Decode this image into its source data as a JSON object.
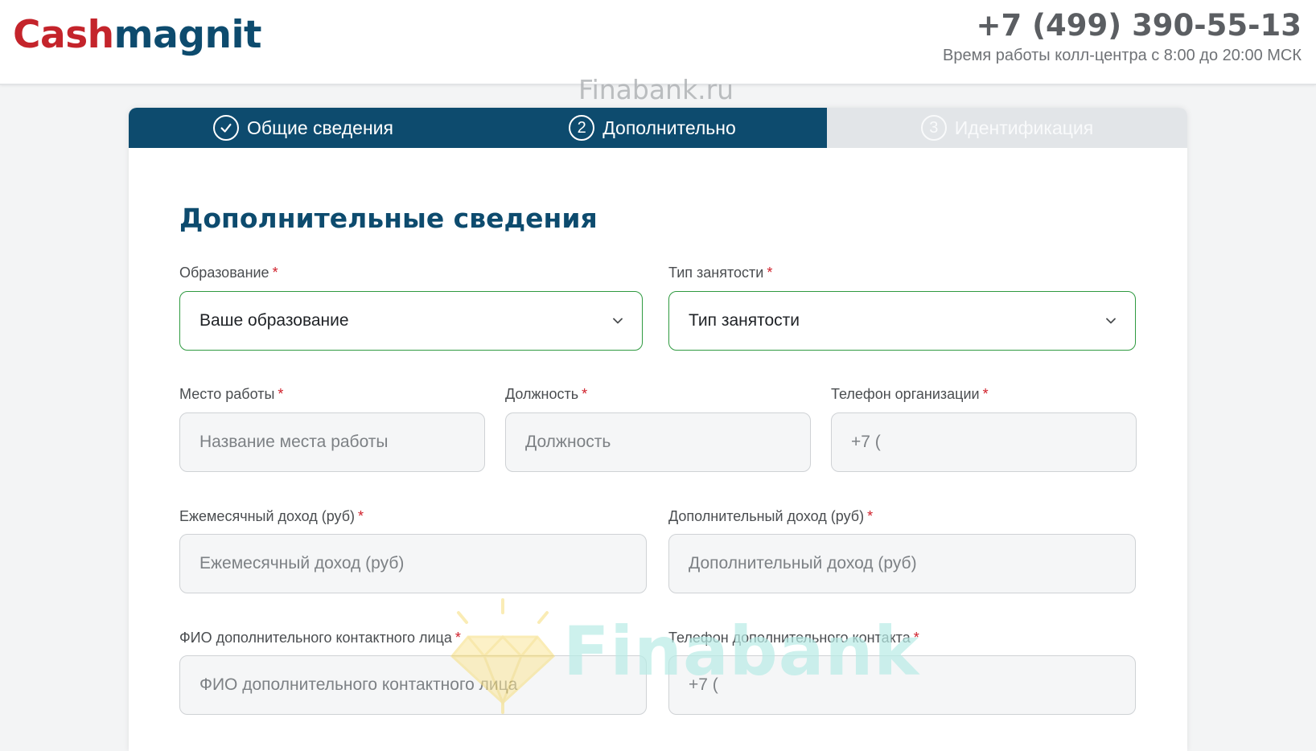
{
  "header": {
    "logo_part1": "Cash",
    "logo_part2": "magnit",
    "phone": "+7 (499) 390-55-13",
    "hours": "Время работы колл-центра с 8:00 до 20:00 МСК"
  },
  "watermark": {
    "top": "Finabank.ru",
    "bottom": "Finabank"
  },
  "stepper": {
    "steps": [
      {
        "num": "✓",
        "label": "Общие сведения",
        "state": "done"
      },
      {
        "num": "2",
        "label": "Дополнительно",
        "state": "active"
      },
      {
        "num": "3",
        "label": "Идентификация",
        "state": "pending"
      }
    ]
  },
  "form": {
    "title": "Дополнительные сведения",
    "required_mark": "*",
    "education": {
      "label": "Образование",
      "value": "Ваше образование"
    },
    "employment": {
      "label": "Тип занятости",
      "value": "Тип занятости"
    },
    "workplace": {
      "label": "Место работы",
      "placeholder": "Название места работы"
    },
    "position": {
      "label": "Должность",
      "placeholder": "Должность"
    },
    "org_phone": {
      "label": "Телефон организации",
      "placeholder": "+7 ("
    },
    "monthly_income": {
      "label": "Ежемесячный доход (руб)",
      "placeholder": "Ежемесячный доход (руб)"
    },
    "additional_income": {
      "label": "Дополнительный доход (руб)",
      "placeholder": "Дополнительный доход (руб)"
    },
    "contact_name": {
      "label": "ФИО дополнительного контактного лица",
      "placeholder": "ФИО дополнительного контактного лица"
    },
    "contact_phone": {
      "label": "Телефон дополнительного контакта",
      "placeholder": "+7 ("
    }
  },
  "colors": {
    "brand_red": "#c4242b",
    "brand_blue": "#0d4b6e",
    "select_border": "#2f9a40",
    "required": "#d0202b"
  }
}
